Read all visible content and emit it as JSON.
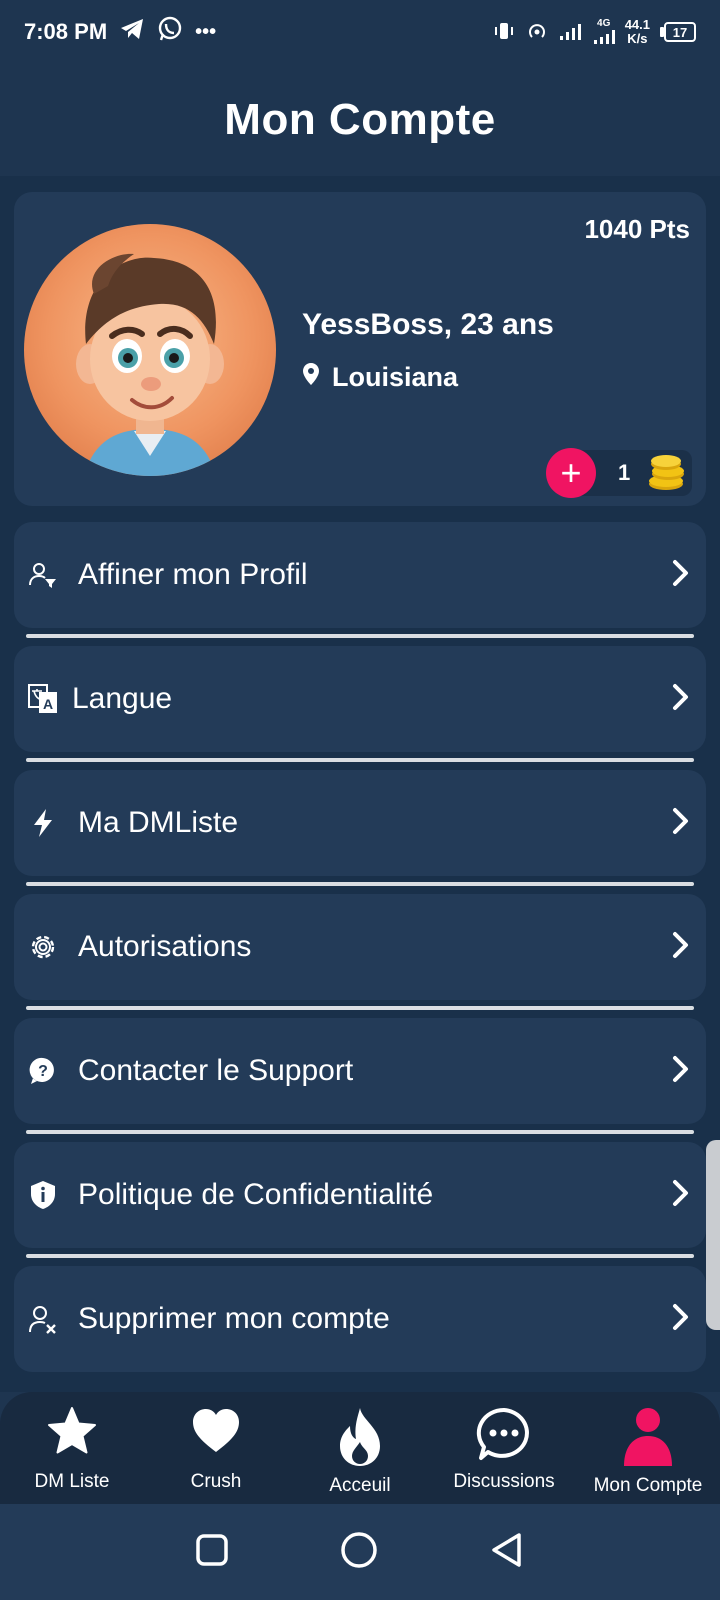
{
  "status": {
    "time": "7:08 PM",
    "more": "•••",
    "network": "4G",
    "speed_value": "44.1",
    "speed_unit": "K/s",
    "battery": "17"
  },
  "header": {
    "title": "Mon Compte"
  },
  "profile": {
    "points": "1040 Pts",
    "name": "YessBoss, 23 ans",
    "location": "Louisiana",
    "coins": "1",
    "add_symbol": "+"
  },
  "menu": [
    {
      "label": "Affiner mon Profil",
      "icon": "user-filter-icon"
    },
    {
      "label": "Langue",
      "icon": "translate-icon"
    },
    {
      "label": "Ma DMListe",
      "icon": "bolt-icon"
    },
    {
      "label": "Autorisations",
      "icon": "gear-icon"
    },
    {
      "label": "Contacter le Support",
      "icon": "question-circle-icon"
    },
    {
      "label": "Politique de Confidentialité",
      "icon": "shield-info-icon"
    },
    {
      "label": "Supprimer mon compte",
      "icon": "user-remove-icon"
    }
  ],
  "nav": [
    {
      "label": "DM Liste",
      "icon": "star-icon",
      "active": false
    },
    {
      "label": "Crush",
      "icon": "heart-icon",
      "active": false
    },
    {
      "label": "Acceuil",
      "icon": "flame-icon",
      "active": false
    },
    {
      "label": "Discussions",
      "icon": "chat-bubble-icon",
      "active": false
    },
    {
      "label": "Mon Compte",
      "icon": "person-icon",
      "active": true
    }
  ],
  "colors": {
    "background": "#1e3550",
    "card": "#233b58",
    "accent": "#f01462",
    "coin": "#f2c314"
  }
}
